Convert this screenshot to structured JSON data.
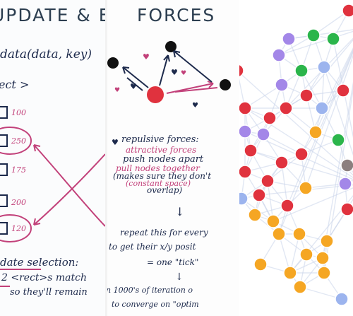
{
  "panels": {
    "update": {
      "title": "UPDATE & E",
      "code_line": "data(data, key)",
      "code_key": "key",
      "rect_tag": "ect >",
      "values": [
        "100",
        "250",
        "175",
        "200",
        "120"
      ],
      "selection_label": "date selection:",
      "selection_line2": "2 <rect>s match",
      "selection_line3": "so they'll remain"
    },
    "forces": {
      "title": "FORCES",
      "line_repulsive": "repulsive forces:",
      "line_push": "push nodes apart",
      "line_attractive": "attractive forces",
      "line_pull": "pull nodes together",
      "line_makesure": "(makes sure they don't",
      "line_overlap": "overlap)",
      "line_constant": "(constant space)",
      "arrow": "↓",
      "line_repeat": "repeat this for every",
      "line_getxy": "to get their x/y posit",
      "line_tick": "= one \"tick\"",
      "arrow2": "↓",
      "line_iter": "n 1000's of iteration o",
      "line_converge": "to converge on \"optim"
    },
    "graph": {
      "colors": {
        "red": "#e0323e",
        "purple": "#a387e8",
        "green": "#2bb54b",
        "blue": "#9cb4ee",
        "orange": "#f5a623",
        "gray": "#8c7f7f",
        "edge": "#c9d3ea"
      }
    }
  }
}
